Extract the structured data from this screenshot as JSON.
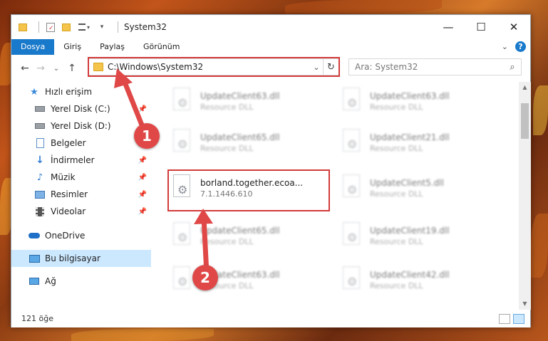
{
  "window": {
    "title": "System32"
  },
  "window_controls": {
    "minimize": "—",
    "maximize": "☐",
    "close": "✕"
  },
  "ribbon": {
    "tabs": [
      "Dosya",
      "Giriş",
      "Paylaş",
      "Görünüm"
    ],
    "expand": "⌄",
    "help": "?"
  },
  "nav": {
    "back": "←",
    "forward": "→",
    "recent": "⌄",
    "up": "↑"
  },
  "address": {
    "path": "C:\\Windows\\System32",
    "dropdown": "⌄",
    "refresh": "↻"
  },
  "search": {
    "placeholder": "Ara: System32",
    "icon": "⌕"
  },
  "sidebar": {
    "quick_access": "Hızlı erişim",
    "items": [
      {
        "label": "Yerel Disk (C:)",
        "pinned": true
      },
      {
        "label": "Yerel Disk (D:)",
        "pinned": false
      },
      {
        "label": "Belgeler",
        "pinned": true
      },
      {
        "label": "İndirmeler",
        "pinned": true
      },
      {
        "label": "Müzik",
        "pinned": true
      },
      {
        "label": "Resimler",
        "pinned": true
      },
      {
        "label": "Videolar",
        "pinned": true
      }
    ],
    "onedrive": "OneDrive",
    "this_pc": "Bu bilgisayar",
    "network": "Ağ"
  },
  "files": {
    "left": [
      {
        "name": "UpdateClient63.dll",
        "desc": "Resource DLL"
      },
      {
        "name": "UpdateClient65.dll",
        "desc": "Resource DLL"
      },
      {
        "name": "borland.together.ecoa...",
        "desc": "7.1.1446.610"
      },
      {
        "name": "UpdateClient65.dll",
        "desc": "Resource DLL"
      },
      {
        "name": "UpdateClient63.dll",
        "desc": "Resource DLL"
      }
    ],
    "right": [
      {
        "name": "UpdateClient63.dll",
        "desc": "Resource DLL"
      },
      {
        "name": "UpdateClient21.dll",
        "desc": "Resource DLL"
      },
      {
        "name": "UpdateClient5.dll",
        "desc": "Resource DLL"
      },
      {
        "name": "UpdateClient19.dll",
        "desc": "Resource DLL"
      },
      {
        "name": "UpdateClient42.dll",
        "desc": "Resource DLL"
      }
    ]
  },
  "status": {
    "count": "121 öğe"
  },
  "annotations": {
    "step1": "1",
    "step2": "2",
    "color": "#e04848"
  }
}
